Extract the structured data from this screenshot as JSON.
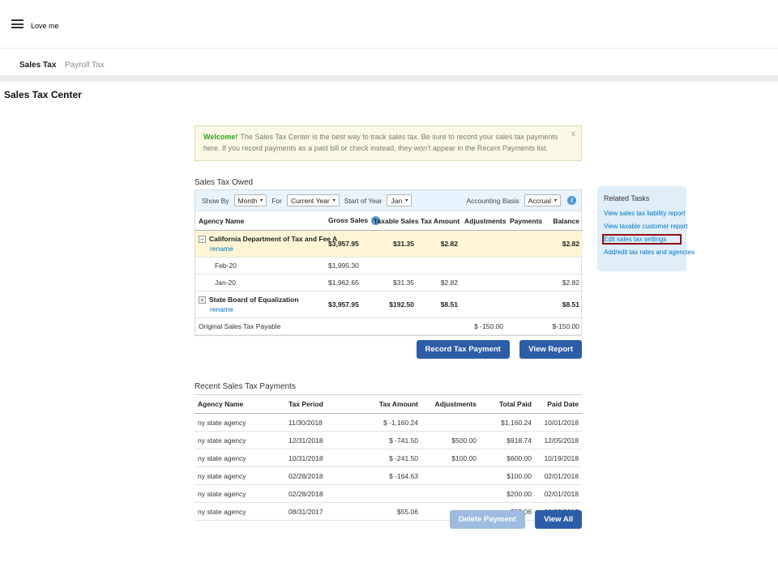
{
  "topbar": {
    "app_name": "Love me"
  },
  "tabs": {
    "sales_tax": "Sales Tax",
    "payroll_tax": "Payroll Tax"
  },
  "page_title": "Sales Tax Center",
  "banner": {
    "welcome": "Welcome!",
    "message": "The Sales Tax Center is the best way to track sales tax. Be sure to record your sales tax payments here. If you record payments as a paid bill or check instead, they won't appear in the Recent Payments list.",
    "close": "x"
  },
  "sales_tax_owed": {
    "title": "Sales Tax Owed",
    "controls": {
      "show_by_label": "Show By",
      "show_by_value": "Month",
      "for_label": "For",
      "for_value": "Current Year",
      "start_of_year_label": "Start of Year",
      "start_of_year_value": "Jan",
      "accounting_basis_label": "Accounting Basis",
      "accounting_basis_value": "Accrual"
    },
    "columns": [
      {
        "label": "Agency Name"
      },
      {
        "label": "Gross Sales",
        "info": true
      },
      {
        "label": "Taxable Sales"
      },
      {
        "label": "Tax Amount"
      },
      {
        "label": "Adjustments"
      },
      {
        "label": "Payments"
      },
      {
        "label": "Balance"
      }
    ],
    "rows": [
      {
        "style": "agency",
        "expand": "minus",
        "highlight": true,
        "name": "California Department of Tax and Fee A",
        "rename": "rename",
        "cells": [
          "$3,957.95",
          "$31.35",
          "$2.82",
          "",
          "",
          "$2.82"
        ]
      },
      {
        "style": "sub",
        "name": "Feb-20",
        "cells": [
          "$1,995.30",
          "",
          "",
          "",
          "",
          ""
        ]
      },
      {
        "style": "sub",
        "name": "Jan-20",
        "cells": [
          "$1,962.65",
          "$31.35",
          "$2.82",
          "",
          "",
          "$2.82"
        ]
      },
      {
        "style": "agency",
        "expand": "plus",
        "name": "State Board of Equalization",
        "rename": "rename",
        "cells": [
          "$3,957.95",
          "$192.50",
          "$8.51",
          "",
          "",
          "$8.51"
        ]
      },
      {
        "style": "total",
        "name": "Original Sales Tax Payable",
        "cells": [
          "",
          "",
          "",
          "$ -150.00",
          "",
          "$-150.00"
        ]
      }
    ],
    "buttons": {
      "record": "Record Tax Payment",
      "view_report": "View Report"
    }
  },
  "related_tasks": {
    "title": "Related Tasks",
    "links": [
      {
        "label": "View sales tax liability report"
      },
      {
        "label": "View taxable customer report"
      },
      {
        "label": "Edit sales tax settings",
        "highlighted": true
      },
      {
        "label": "Add/edit tax rates and agencies"
      }
    ]
  },
  "recent_payments": {
    "title": "Recent Sales Tax Payments",
    "columns": [
      "Agency Name",
      "Tax Period",
      "Tax Amount",
      "Adjustments",
      "Total Paid",
      "Paid Date"
    ],
    "rows": [
      [
        "ny state agency",
        "11/30/2018",
        "$ -1,160.24",
        "",
        "$1,160.24",
        "10/01/2018"
      ],
      [
        "ny state agency",
        "12/31/2018",
        "$ -741.50",
        "$500.00",
        "$918.74",
        "12/05/2018"
      ],
      [
        "ny state agency",
        "10/31/2018",
        "$ -241.50",
        "$100.00",
        "$600.00",
        "10/19/2018"
      ],
      [
        "ny state agency",
        "02/28/2018",
        "$ -164.63",
        "",
        "$100.00",
        "02/01/2018"
      ],
      [
        "ny state agency",
        "02/28/2018",
        "",
        "",
        "$200.00",
        "02/01/2018"
      ],
      [
        "ny state agency",
        "08/31/2017",
        "$55.06",
        "",
        "$55.06",
        "08/22/2017"
      ]
    ],
    "buttons": {
      "delete": "Delete Payment",
      "view_all": "View All"
    }
  },
  "colors": {
    "brand_green": "#2ca01c",
    "link_blue": "#0077c5",
    "button_blue": "#2e5da8",
    "highlight_row": "#fdf5d5",
    "annotation_red": "#8e1212"
  }
}
